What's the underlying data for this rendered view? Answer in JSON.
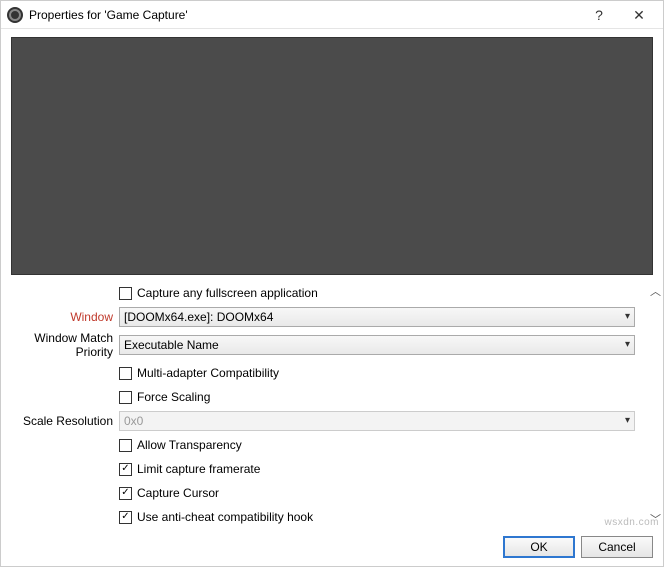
{
  "titlebar": {
    "title": "Properties for 'Game Capture'",
    "help": "?",
    "close": "✕"
  },
  "labels": {
    "window": "Window",
    "priority": "Window Match Priority",
    "scaleRes": "Scale Resolution"
  },
  "options": {
    "captureFullscreen": "Capture any fullscreen application",
    "windowValue": "[DOOMx64.exe]: DOOMx64",
    "priorityValue": "Executable Name",
    "multiAdapter": "Multi-adapter Compatibility",
    "forceScaling": "Force Scaling",
    "scaleResValue": "0x0",
    "allowTransparency": "Allow Transparency",
    "limitFramerate": "Limit capture framerate",
    "captureCursor": "Capture Cursor",
    "antiCheat": "Use anti-cheat compatibility hook"
  },
  "checked": {
    "captureFullscreen": false,
    "multiAdapter": false,
    "forceScaling": false,
    "allowTransparency": false,
    "limitFramerate": true,
    "captureCursor": true,
    "antiCheat": true
  },
  "buttons": {
    "ok": "OK",
    "cancel": "Cancel"
  },
  "watermark": "wsxdn.com"
}
